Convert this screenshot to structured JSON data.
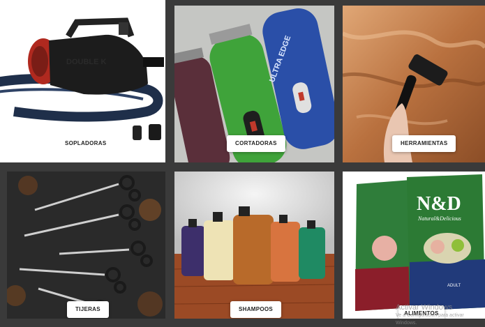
{
  "categories": [
    {
      "id": "sopladoras",
      "label": "SOPLADORAS"
    },
    {
      "id": "cortadoras",
      "label": "CORTADORAS"
    },
    {
      "id": "herramientas",
      "label": "HERRAMIENTAS"
    },
    {
      "id": "tijeras",
      "label": "TIJERAS"
    },
    {
      "id": "shampoos",
      "label": "SHAMPOOS"
    },
    {
      "id": "alimentos",
      "label": "ALIMENTOS"
    }
  ],
  "product_text": {
    "clipper_brand": "ULTRA EDGE",
    "food_brand": "N&D",
    "food_sub": "Natural&Delicious",
    "food_variant": "ADULT"
  },
  "watermark": {
    "title": "Activar Windows",
    "subtitle": "Ve a Configuración para activar Windows."
  },
  "colors": {
    "background": "#3a3a3a",
    "label_bg": "#ffffff",
    "clipper_green": "#3fa33a",
    "clipper_blue": "#2a4fa8",
    "clipper_purple": "#5a2f3a",
    "dryer_red": "#b0291f"
  }
}
